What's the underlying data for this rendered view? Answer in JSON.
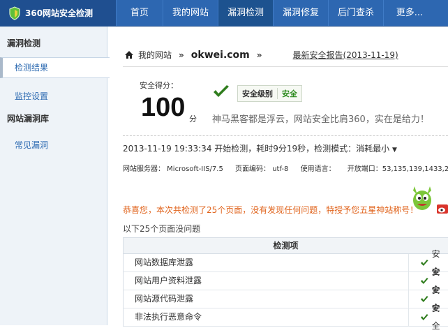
{
  "brand": {
    "name": "360网站安全检测",
    "icon": "shield-logo-icon"
  },
  "nav": {
    "items": [
      {
        "label": "首页",
        "active": false
      },
      {
        "label": "我的网站",
        "active": false
      },
      {
        "label": "漏洞检测",
        "active": true
      },
      {
        "label": "漏洞修复",
        "active": false
      },
      {
        "label": "后门查杀",
        "active": false
      },
      {
        "label": "更多...",
        "active": false
      }
    ]
  },
  "sidebar": {
    "section1_title": "漏洞检测",
    "items": [
      {
        "label": "检测结果",
        "active": true
      },
      {
        "label": "监控设置",
        "active": false
      }
    ],
    "section2_title": "网站漏洞库",
    "items2": [
      {
        "label": "常见漏洞"
      }
    ]
  },
  "breadcrumb": {
    "home_label": "我的网站",
    "sep1": "»",
    "domain": "okwei.com",
    "sep2": "»",
    "report_link": "最新安全报告(2013-11-19)"
  },
  "score": {
    "label": "安全得分：",
    "value": "100",
    "unit": "分",
    "level_key": "安全级别",
    "level_value": "安全",
    "slogan": "神马黑客都是浮云，网站安全比肩360，实在是给力！"
  },
  "scan": {
    "info": "2013-11-19 19:33:34 开始检测，耗时9分19秒，检测模式：消耗最小",
    "caret": "▼",
    "server": "网站服务器： Microsoft-IIS/7.5",
    "encoding": "页面编码： utf-8",
    "language": "使用语言：",
    "ports": "开放端口：53,135,139,1433,2383"
  },
  "result": {
    "congrats": "恭喜您，本次共检测了25个页面，没有发现任何问题，特授予您五星神站称号！",
    "no_problem": "以下25个页面没问题",
    "table_header": "检测项",
    "rows": [
      {
        "name": "网站数据库泄露",
        "status": "安全"
      },
      {
        "name": "网站用户资料泄露",
        "status": "安全"
      },
      {
        "name": "网站源代码泄露",
        "status": "安全"
      },
      {
        "name": "非法执行恶意命令",
        "status": "安全"
      }
    ]
  },
  "colors": {
    "nav_bg": "#2d67b1",
    "accent_green": "#2e8b1f",
    "warning_orange": "#e0621a"
  }
}
